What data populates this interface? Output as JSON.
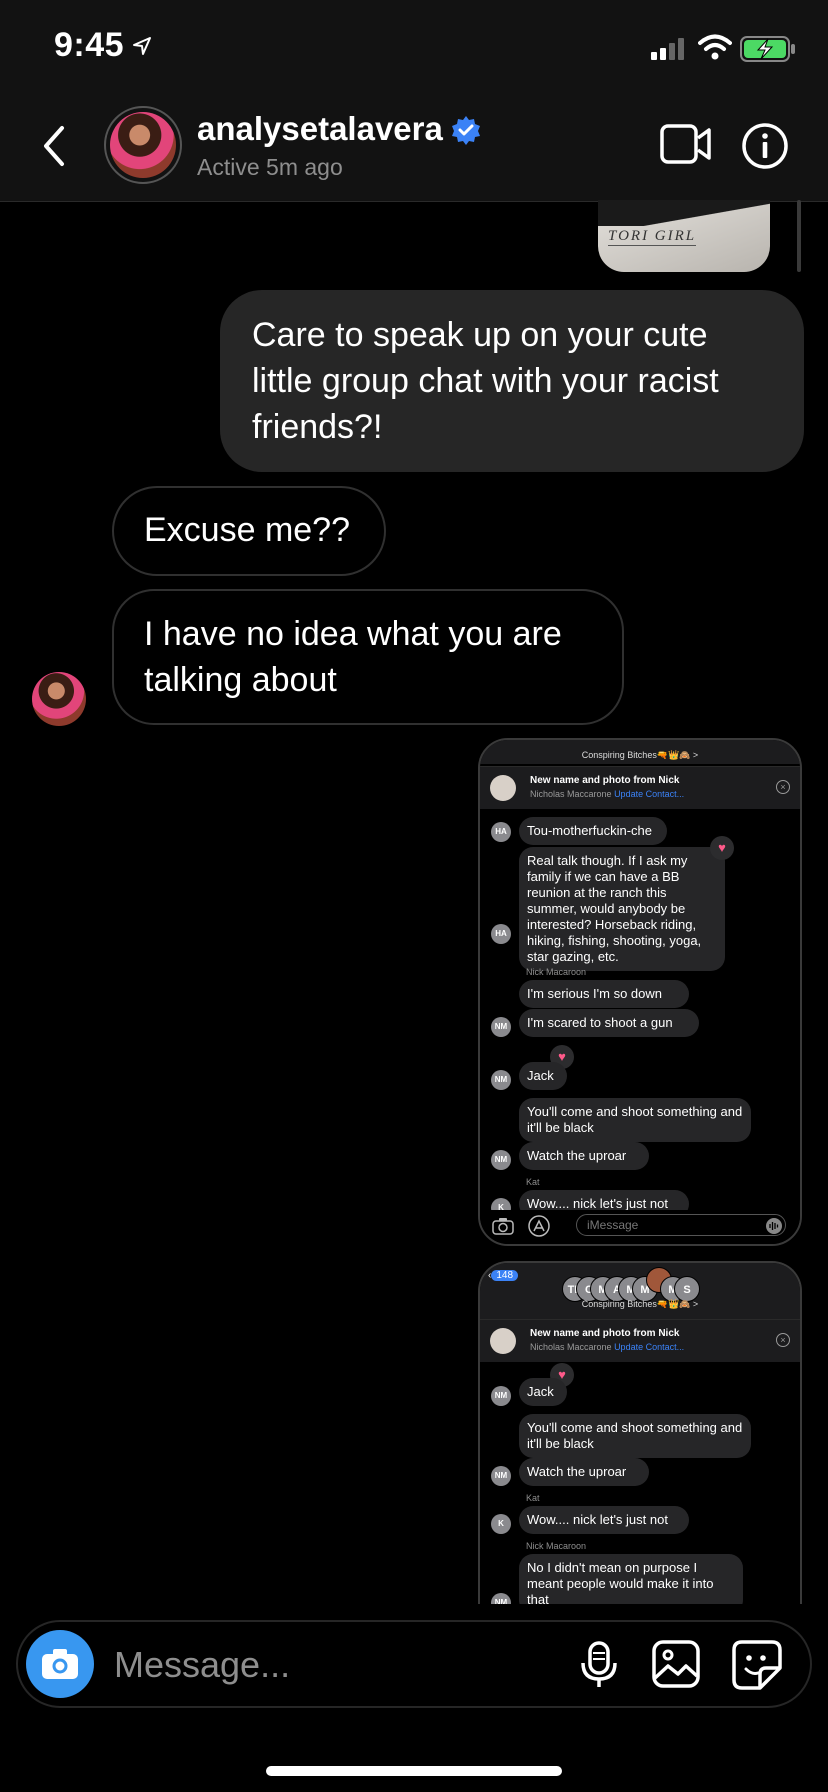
{
  "status_bar": {
    "time": "9:45"
  },
  "header": {
    "username": "analysetalavera",
    "active_status": "Active 5m ago"
  },
  "top_image": {
    "caption": "TORI GIRL"
  },
  "messages": [
    {
      "from": "me",
      "text": "Care to speak up on your cute little group chat with your racist friends?!"
    },
    {
      "from": "them",
      "text": "Excuse me??"
    },
    {
      "from": "them",
      "text": "I have no idea what you are talking about"
    }
  ],
  "screenshot1": {
    "group_name": "Conspiring Bitches🔫👑🙈 >",
    "banner_title": "New name and photo from Nick",
    "banner_sub": "Nicholas Maccarone",
    "banner_link": "Update Contact...",
    "rows": [
      {
        "initials": "HA",
        "text": "Tou-motherfuckin-che"
      },
      {
        "initials": "HA",
        "text": "Real talk though. If I ask my family if we can have a BB reunion at the ranch this summer, would anybody be interested? Horseback riding, hiking, fishing, shooting, yoga, star gazing, etc."
      },
      {
        "name": "Nick Macaroon"
      },
      {
        "text": "I'm serious I'm so down"
      },
      {
        "initials": "NM",
        "text": "I'm scared to shoot a gun"
      },
      {
        "initials": "NM",
        "text": "Jack"
      },
      {
        "text": "You'll come and shoot something and it'll be black"
      },
      {
        "initials": "NM",
        "text": "Watch the uproar"
      },
      {
        "name": "Kat"
      },
      {
        "initials": "K",
        "text": "Wow.... nick let's just not"
      }
    ],
    "imessage_placeholder": "iMessage"
  },
  "screenshot2": {
    "back_count": "148",
    "avatars": [
      "TB",
      "C",
      "M",
      "A",
      "M",
      "M",
      "",
      "M",
      "S"
    ],
    "group_name": "Conspiring Bitches🔫👑🙈 >",
    "banner_title": "New name and photo from Nick",
    "banner_sub": "Nicholas Maccarone",
    "banner_link": "Update Contact...",
    "rows": [
      {
        "initials": "NM",
        "text": "Jack"
      },
      {
        "text": "You'll come and shoot something and it'll be black"
      },
      {
        "initials": "NM",
        "text": "Watch the uproar"
      },
      {
        "name": "Kat"
      },
      {
        "initials": "K",
        "text": "Wow.... nick let's just not"
      },
      {
        "name": "Nick Macaroon"
      },
      {
        "initials": "NM",
        "text": "No I didn't mean on purpose I meant people would make it into that"
      }
    ]
  },
  "composer": {
    "placeholder": "Message..."
  },
  "colors": {
    "accent_blue": "#3897f0",
    "bubble_gray": "#262626",
    "verified_blue": "#3b82f6"
  },
  "icons": [
    "location-arrow-icon",
    "signal-icon",
    "wifi-icon",
    "battery-charging-icon",
    "back-chevron-icon",
    "verified-badge-icon",
    "video-call-icon",
    "info-icon",
    "camera-icon",
    "microphone-icon",
    "gallery-icon",
    "sticker-icon"
  ]
}
